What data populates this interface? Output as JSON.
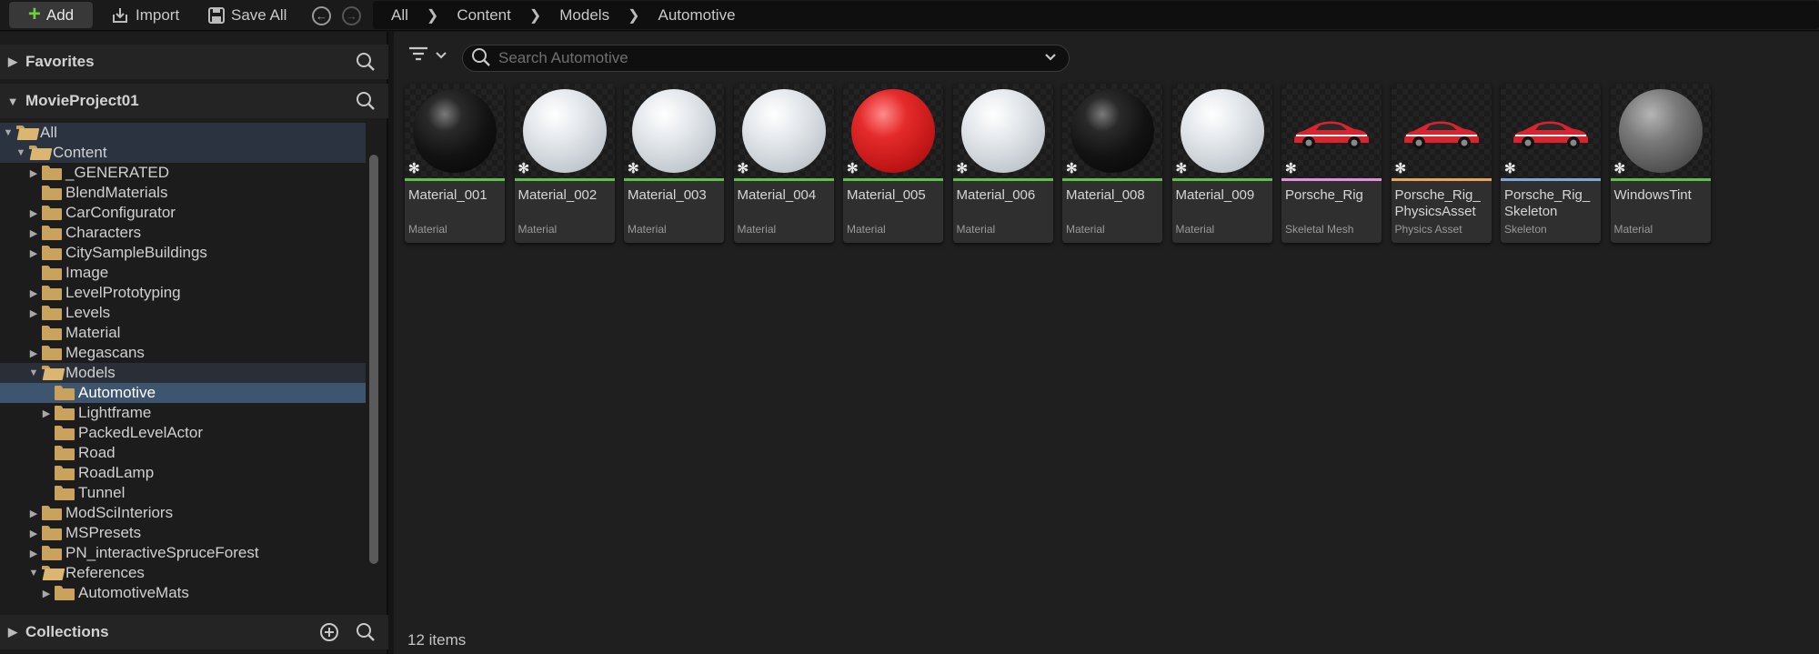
{
  "toolbar": {
    "add_label": "Add",
    "import_label": "Import",
    "save_all_label": "Save All"
  },
  "breadcrumb": [
    "All",
    "Content",
    "Models",
    "Automotive"
  ],
  "favorites": {
    "title": "Favorites"
  },
  "project": {
    "title": "MovieProject01"
  },
  "tree": [
    {
      "label": "All"
    },
    {
      "label": "Content"
    },
    {
      "label": "_GENERATED"
    },
    {
      "label": "BlendMaterials"
    },
    {
      "label": "CarConfigurator"
    },
    {
      "label": "Characters"
    },
    {
      "label": "CitySampleBuildings"
    },
    {
      "label": "Image"
    },
    {
      "label": "LevelPrototyping"
    },
    {
      "label": "Levels"
    },
    {
      "label": "Material"
    },
    {
      "label": "Megascans"
    },
    {
      "label": "Models"
    },
    {
      "label": "Automotive"
    },
    {
      "label": "Lightframe"
    },
    {
      "label": "PackedLevelActor"
    },
    {
      "label": "Road"
    },
    {
      "label": "RoadLamp"
    },
    {
      "label": "Tunnel"
    },
    {
      "label": "ModSciInteriors"
    },
    {
      "label": "MSPresets"
    },
    {
      "label": "PN_interactiveSpruceForest"
    },
    {
      "label": "References"
    },
    {
      "label": "AutomotiveMats"
    }
  ],
  "collections": {
    "title": "Collections"
  },
  "search": {
    "placeholder": "Search Automotive"
  },
  "assets": [
    {
      "name": "Material_001",
      "type": "Material",
      "type_color": "#5ec04a",
      "preview": "black-sphere"
    },
    {
      "name": "Material_002",
      "type": "Material",
      "type_color": "#5ec04a",
      "preview": "white-sphere"
    },
    {
      "name": "Material_003",
      "type": "Material",
      "type_color": "#5ec04a",
      "preview": "white-sphere"
    },
    {
      "name": "Material_004",
      "type": "Material",
      "type_color": "#5ec04a",
      "preview": "white-sphere"
    },
    {
      "name": "Material_005",
      "type": "Material",
      "type_color": "#5ec04a",
      "preview": "red-sphere"
    },
    {
      "name": "Material_006",
      "type": "Material",
      "type_color": "#5ec04a",
      "preview": "white-sphere"
    },
    {
      "name": "Material_008",
      "type": "Material",
      "type_color": "#5ec04a",
      "preview": "black-sphere"
    },
    {
      "name": "Material_009",
      "type": "Material",
      "type_color": "#5ec04a",
      "preview": "white-sphere"
    },
    {
      "name": "Porsche_Rig",
      "type": "Skeletal Mesh",
      "type_color": "#e48fe0",
      "preview": "car"
    },
    {
      "name": "Porsche_Rig_PhysicsAsset",
      "type": "Physics Asset",
      "type_color": "#e8a65a",
      "preview": "car"
    },
    {
      "name": "Porsche_Rig_Skeleton",
      "type": "Skeleton",
      "type_color": "#7fa8d8",
      "preview": "car"
    },
    {
      "name": "WindowsTint",
      "type": "Material",
      "type_color": "#5ec04a",
      "preview": "gray-sphere"
    }
  ],
  "status": {
    "items_count": "12 items"
  }
}
